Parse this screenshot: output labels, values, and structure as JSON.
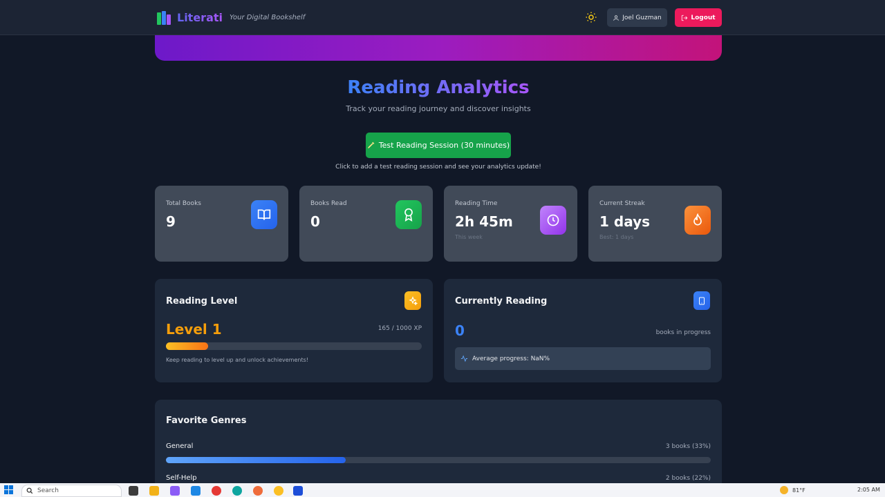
{
  "header": {
    "brand_name": "Literati",
    "brand_tagline": "Your Digital Bookshelf",
    "user_name": "Joel Guzman",
    "logout_label": "Logout",
    "theme_icon": "sun-icon"
  },
  "hero": {
    "title": "Reading Analytics",
    "subtitle": "Track your reading journey and discover insights",
    "test_button_label": "Test Reading Session (30 minutes)",
    "test_hint": "Click to add a test reading session and see your analytics update!"
  },
  "stats": [
    {
      "label": "Total Books",
      "value": "9",
      "note": "",
      "icon": "book-open-icon",
      "color": "#3b82f6"
    },
    {
      "label": "Books Read",
      "value": "0",
      "note": "",
      "icon": "award-icon",
      "color": "#22c55e"
    },
    {
      "label": "Reading Time",
      "value": "2h 45m",
      "note": "This week",
      "icon": "clock-icon",
      "color": "#a855f7"
    },
    {
      "label": "Current Streak",
      "value": "1 days",
      "note": "Best: 1 days",
      "icon": "flame-icon",
      "color": "#f97316"
    }
  ],
  "reading_level": {
    "title": "Reading Level",
    "level": "Level 1",
    "xp": "165 / 1000 XP",
    "xp_fraction": 0.165,
    "hint": "Keep reading to level up and unlock achievements!"
  },
  "currently_reading": {
    "title": "Currently Reading",
    "count": "0",
    "count_label": "books in progress",
    "average": "Average progress: NaN%"
  },
  "genres": {
    "title": "Favorite Genres",
    "items": [
      {
        "name": "General",
        "count": "3 books (33%)",
        "fraction": 0.33
      },
      {
        "name": "Self-Help",
        "count": "2 books (22%)",
        "fraction": 0.22
      }
    ]
  },
  "taskbar": {
    "search_placeholder": "Search",
    "temperature": "81°F",
    "time": "2:05 AM"
  },
  "colors": {
    "background": "#111827",
    "card": "#1e293b",
    "accent_green": "#16a34a",
    "logout_pink": "#ec1a5c",
    "level_orange": "#f59e0b"
  }
}
